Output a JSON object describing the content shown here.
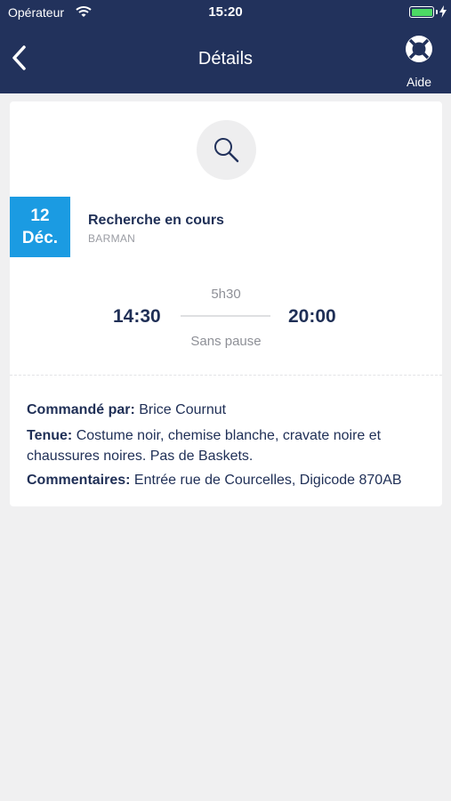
{
  "status_bar": {
    "carrier": "Opérateur",
    "time": "15:20",
    "battery_level": 1.0,
    "battery_color": "#4cd964"
  },
  "nav": {
    "title": "Détails",
    "back_icon": "chevron-left-icon",
    "help_icon": "lifebuoy-icon",
    "help_label": "Aide",
    "background": "#22325c"
  },
  "mission": {
    "status_icon": "search-icon",
    "date_day": "12",
    "date_month": "Déc.",
    "date_color": "#1b9be2",
    "status": "Recherche en cours",
    "role": "BARMAN",
    "duration": "5h30",
    "start_time": "14:30",
    "end_time": "20:00",
    "pause": "Sans pause"
  },
  "details": {
    "ordered_by_label": "Commandé par:",
    "ordered_by_value": " Brice Cournut",
    "dress_label": "Tenue:",
    "dress_value": " Costume noir, chemise blanche, cravate noire et chaussures noires. Pas de Baskets.",
    "comments_label": "Commentaires:",
    "comments_value": " Entrée rue de Courcelles, Digicode 870AB"
  }
}
